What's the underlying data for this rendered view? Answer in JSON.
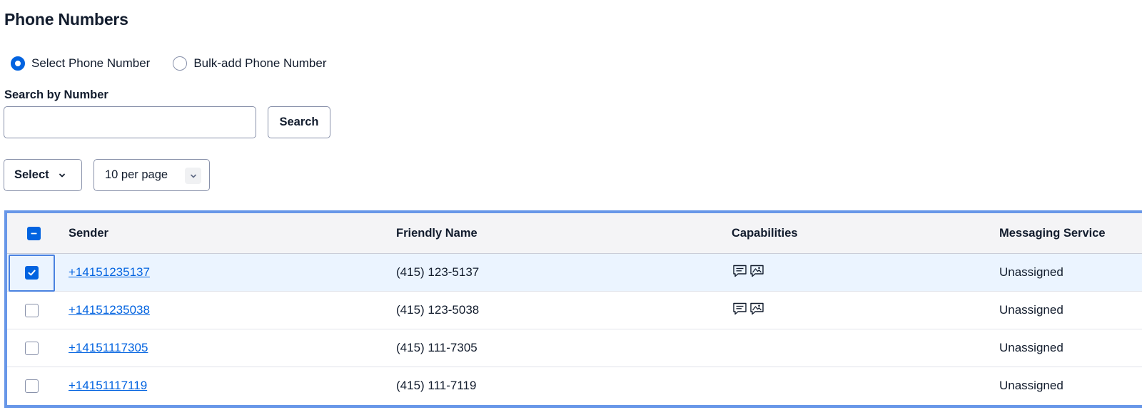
{
  "page_title": "Phone Numbers",
  "radio": {
    "options": [
      {
        "label": "Select Phone Number",
        "checked": true
      },
      {
        "label": "Bulk-add Phone Number",
        "checked": false
      }
    ]
  },
  "search": {
    "label": "Search by Number",
    "value": "",
    "placeholder": "",
    "button_label": "Search"
  },
  "controls": {
    "select_label": "Select",
    "per_page_label": "10 per page"
  },
  "table": {
    "header_checkbox": "indeterminate",
    "columns": [
      "Sender",
      "Friendly Name",
      "Capabilities",
      "Messaging Service"
    ],
    "rows": [
      {
        "checked": true,
        "sender": "+14151235137",
        "friendly_name": "(415) 123-5137",
        "capabilities": [
          "sms-icon",
          "mms-icon"
        ],
        "messaging_service": "Unassigned"
      },
      {
        "checked": false,
        "sender": "+14151235038",
        "friendly_name": "(415) 123-5038",
        "capabilities": [
          "sms-icon",
          "mms-icon"
        ],
        "messaging_service": "Unassigned"
      },
      {
        "checked": false,
        "sender": "+14151117305",
        "friendly_name": "(415) 111-7305",
        "capabilities": [],
        "messaging_service": "Unassigned"
      },
      {
        "checked": false,
        "sender": "+14151117119",
        "friendly_name": "(415) 111-7119",
        "capabilities": [],
        "messaging_service": "Unassigned"
      }
    ]
  },
  "colors": {
    "accent": "#0263e0",
    "focus_border": "#6897e8",
    "selected_row": "#ebf4ff",
    "header_bg": "#f4f4f6"
  }
}
